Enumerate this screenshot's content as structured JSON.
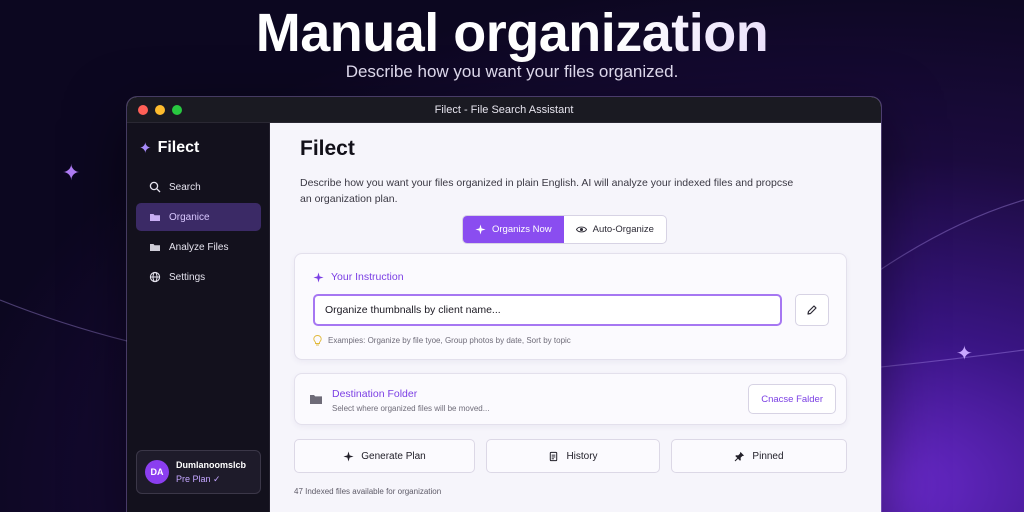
{
  "hero": {
    "title": "Manual organization",
    "subtitle": "Describe how you want your files organized."
  },
  "window": {
    "title": "Filect - File Search Assistant"
  },
  "sidebar": {
    "brand": "Filect",
    "items": [
      {
        "label": "Search",
        "icon": "search-icon"
      },
      {
        "label": "Organice",
        "icon": "folder-icon",
        "active": true
      },
      {
        "label": "Analyze Files",
        "icon": "folder-icon"
      },
      {
        "label": "Settings",
        "icon": "globe-icon"
      }
    ],
    "user": {
      "initials": "DA",
      "name": "Dumlanoomslcb",
      "plan": "Pre Plan ✓"
    }
  },
  "main": {
    "title": "Filect",
    "description": "Describe how you want your files organized in plain English. AI will analyze your indexed files and propcse an organization plan.",
    "modes": [
      "Organizs Now",
      "Auto-Organize"
    ],
    "instruction": {
      "heading": "Your Instruction",
      "value": "Organize thumbnalls by client name...",
      "examples": "Exampies: Organize by file tyoe, Group photos by date, Sort by topic"
    },
    "destination": {
      "title": "Destination Folder",
      "subtitle": "Select where organized files will be moved...",
      "button": "Cnacse Falder"
    },
    "actions": [
      "Generate Plan",
      "History",
      "Pinned"
    ],
    "footnote": "47 Indexed files available for organization"
  },
  "colors": {
    "accent": "#8a4df0",
    "accent_text": "#7b3fe4",
    "sidebar_bg": "#13111d",
    "window_bg": "#f6f5fb"
  }
}
